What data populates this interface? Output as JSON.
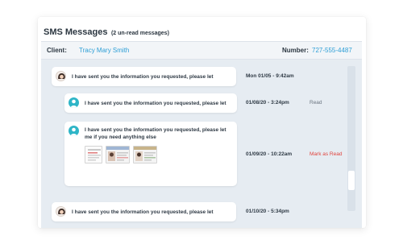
{
  "header": {
    "title": "SMS Messages",
    "subtitle": "(2 un-read messages)"
  },
  "client": {
    "label": "Client:",
    "name": "Tracy Mary Smith",
    "number_label": "Number:",
    "number": "727-555-4487"
  },
  "messages": [
    {
      "sender": "agent",
      "text": "I have sent you the information you requested, please let",
      "time": "Mon 01/05 - 9:42am",
      "status": ""
    },
    {
      "sender": "client",
      "text": "I have sent you the information you requested, please let",
      "time": "01/08/20 - 3:24pm",
      "status": "Read"
    },
    {
      "sender": "client",
      "text": "I have sent you the information you requested, please let me if you need anything else",
      "time": "01/09/20 - 10:22am",
      "status": "Mark as Read",
      "attachments": [
        "document-thumbnail",
        "id-card-thumbnail-1",
        "id-card-thumbnail-2"
      ]
    },
    {
      "sender": "agent",
      "text": "I have sent you the information you requested, please let",
      "time": "01/10/20 - 5:34pm",
      "status": ""
    }
  ],
  "colors": {
    "accent": "#2e9fd6",
    "unread_action": "#e0443e",
    "thread_background": "#e6ecf2"
  }
}
